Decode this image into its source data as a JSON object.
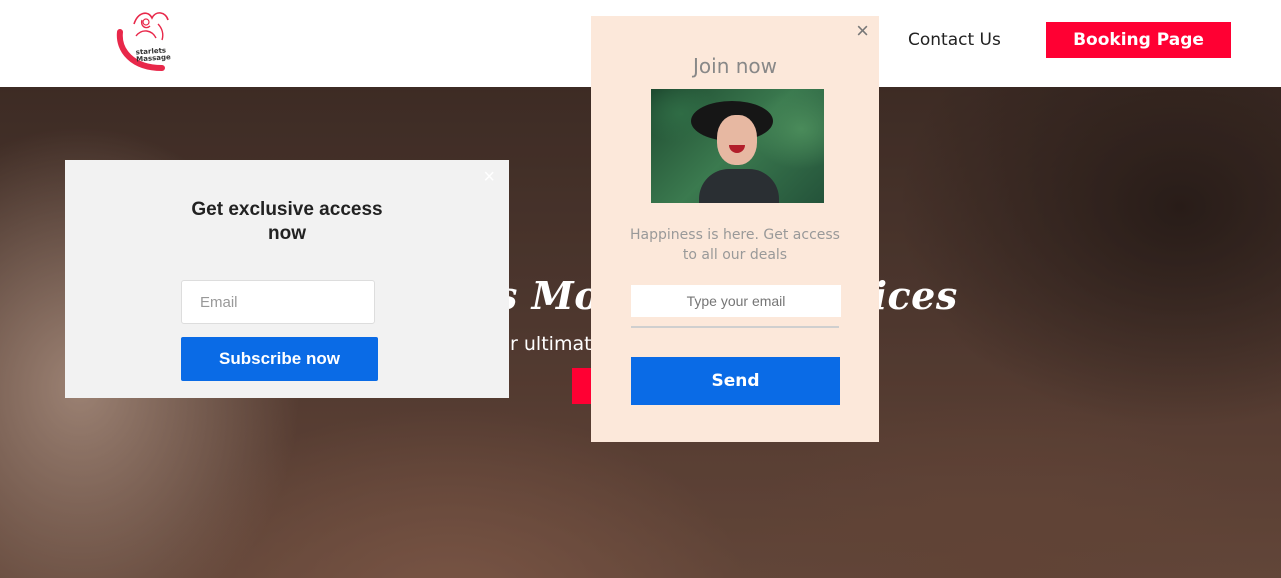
{
  "header": {
    "logo_text": "starlets Massage",
    "nav_contact": "Contact Us",
    "booking_button": "Booking Page"
  },
  "hero": {
    "title_part1": "ts Mo",
    "title_part2": "vices",
    "subtitle": "ur ultimat"
  },
  "popup_exclusive": {
    "close": "×",
    "title": "Get exclusive access now",
    "email_placeholder": "Email",
    "subscribe_label": "Subscribe now"
  },
  "popup_join": {
    "close": "×",
    "title": "Join now",
    "description": "Happiness is here. Get access to all our deals",
    "email_placeholder": "Type your email",
    "send_label": "Send"
  },
  "colors": {
    "accent_red": "#ff0033",
    "button_blue": "#0a6be6",
    "popup_peach": "#fce8da"
  }
}
